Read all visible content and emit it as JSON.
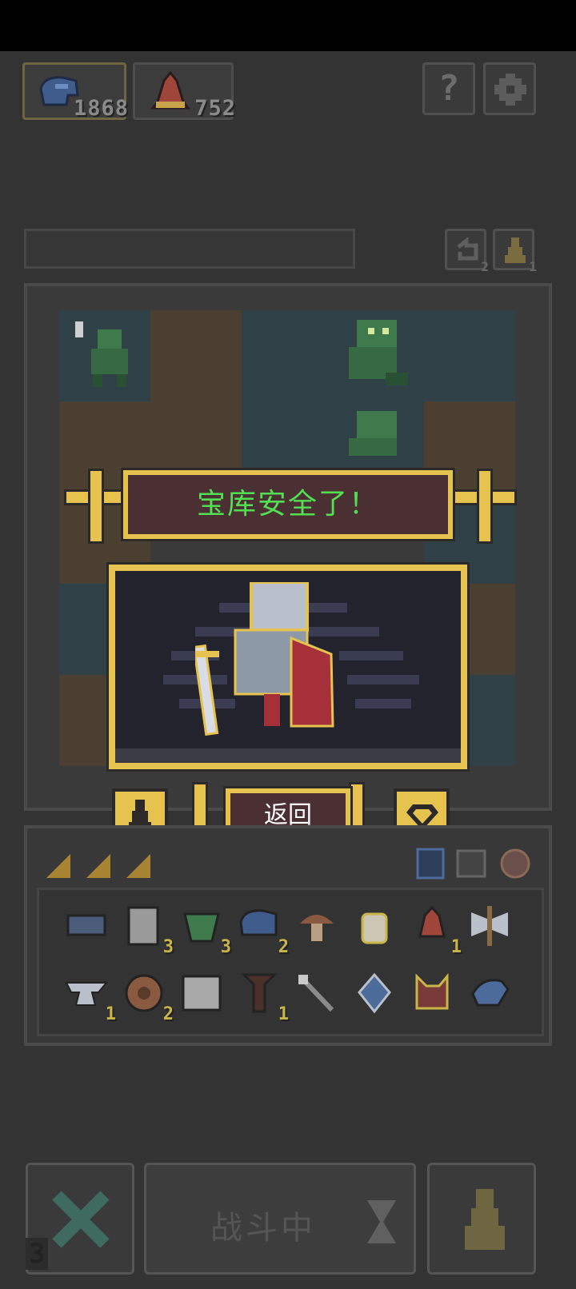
{
  "resources": [
    {
      "name": "blue-hat-icon",
      "count": "1868"
    },
    {
      "name": "red-bell-icon",
      "count": "752"
    }
  ],
  "top_buttons": {
    "help": "?"
  },
  "queue_counts": {
    "rotate": "2",
    "pawn": "1"
  },
  "banner": {
    "title": "宝库安全了！"
  },
  "dialog": {
    "back_label": "返回"
  },
  "inventory": {
    "row1": [
      {
        "icon": "cloth-icon",
        "count": ""
      },
      {
        "icon": "scroll-icon",
        "count": "3"
      },
      {
        "icon": "green-gem-icon",
        "count": "3"
      },
      {
        "icon": "blue-hat-icon",
        "count": "2"
      },
      {
        "icon": "mushroom-icon",
        "count": ""
      },
      {
        "icon": "potion-jar-icon",
        "count": ""
      },
      {
        "icon": "red-bell-icon",
        "count": "1"
      },
      {
        "icon": "double-axe-icon",
        "count": ""
      }
    ],
    "row2": [
      {
        "icon": "anvil-icon",
        "count": "1"
      },
      {
        "icon": "wheel-icon",
        "count": "2"
      },
      {
        "icon": "parchment-icon",
        "count": ""
      },
      {
        "icon": "dark-totem-icon",
        "count": "1"
      },
      {
        "icon": "wand-icon",
        "count": ""
      },
      {
        "icon": "blue-crystal-icon",
        "count": ""
      },
      {
        "icon": "fox-icon",
        "count": ""
      },
      {
        "icon": "blue-bird-icon",
        "count": ""
      }
    ]
  },
  "bottom_bar": {
    "status": "战斗中",
    "corner_count": "3"
  }
}
